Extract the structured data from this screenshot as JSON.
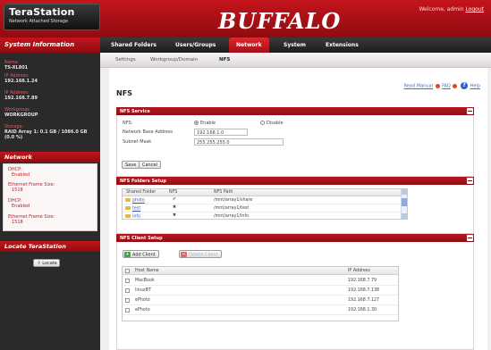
{
  "header": {
    "product_name": "TeraStation",
    "product_tagline": "Network Attached Storage",
    "brand": "BUFFALO",
    "welcome_text": "Welcome, admin",
    "logout_label": "Logout"
  },
  "mainnav": {
    "sidebar_title": "System Information",
    "tabs": [
      {
        "label": "Shared Folders"
      },
      {
        "label": "Users/Groups"
      },
      {
        "label": "Network"
      },
      {
        "label": "System"
      },
      {
        "label": "Extensions"
      }
    ],
    "active_tab": "Network"
  },
  "subnav": {
    "items": [
      {
        "label": "Settings"
      },
      {
        "label": "Workgroup/Domain"
      },
      {
        "label": "NFS"
      }
    ],
    "active": "NFS"
  },
  "sidebar": {
    "info": [
      {
        "key": "Name:",
        "value": "TS-XL801"
      },
      {
        "key": "IP Address:",
        "value": "192.168.1.24"
      },
      {
        "key": "IP Address:",
        "value": "192.168.7.89"
      },
      {
        "key": "Workgroup:",
        "value": "WORKGROUP"
      },
      {
        "key": "Storage:",
        "value": "RAID Array 1: 0.1 GB / 1086.0 GB (0.0 %)"
      }
    ],
    "network_title": "Network",
    "network": [
      {
        "key": "DHCP:",
        "value": "Enabled"
      },
      {
        "key": "Ethernet Frame Size:",
        "value": "1518"
      },
      {
        "key": "DHCP:",
        "value": "Enabled"
      },
      {
        "key": "Ethernet Frame Size:",
        "value": "1518"
      }
    ],
    "locate_title": "Locate TeraStation",
    "locate_button": "Locate"
  },
  "content": {
    "page_title": "NFS",
    "help": {
      "read_manual": "Read Manual",
      "faq": "FAQ",
      "help": "Help"
    },
    "nfs_service": {
      "title": "NFS Service",
      "nfs_label": "NFS:",
      "enable_label": "Enable",
      "disable_label": "Disable",
      "selected": "Enable",
      "network_address_label": "Network Base Address",
      "network_address_value": "192.168.1.0",
      "subnet_mask_label": "Subnet Mask",
      "subnet_mask_value": "255.255.255.0",
      "save_label": "Save",
      "cancel_label": "Cancel"
    },
    "nfs_folders": {
      "title": "NFS Folders Setup",
      "columns": [
        "Shared Folder",
        "NFS",
        "NFS Path"
      ],
      "rows": [
        {
          "folder": "photo",
          "enabled": true,
          "path": "/mnt/array1/share"
        },
        {
          "folder": "test",
          "enabled": false,
          "path": "/mnt/array1/test"
        },
        {
          "folder": "info",
          "enabled": false,
          "path": "/mnt/array1/info"
        }
      ]
    },
    "nfs_clients": {
      "title": "NFS Client Setup",
      "add_label": "Add Client",
      "delete_label": "Delete Client",
      "columns": [
        "Host Name",
        "IP Address"
      ],
      "rows": [
        {
          "host": "MacBook",
          "ip": "192.168.7.79"
        },
        {
          "host": "linuxBT",
          "ip": "192.168.7.138"
        },
        {
          "host": "ePhoto",
          "ip": "192.168.7.127"
        },
        {
          "host": "ePhoto",
          "ip": "192.168.1.30"
        }
      ]
    }
  }
}
